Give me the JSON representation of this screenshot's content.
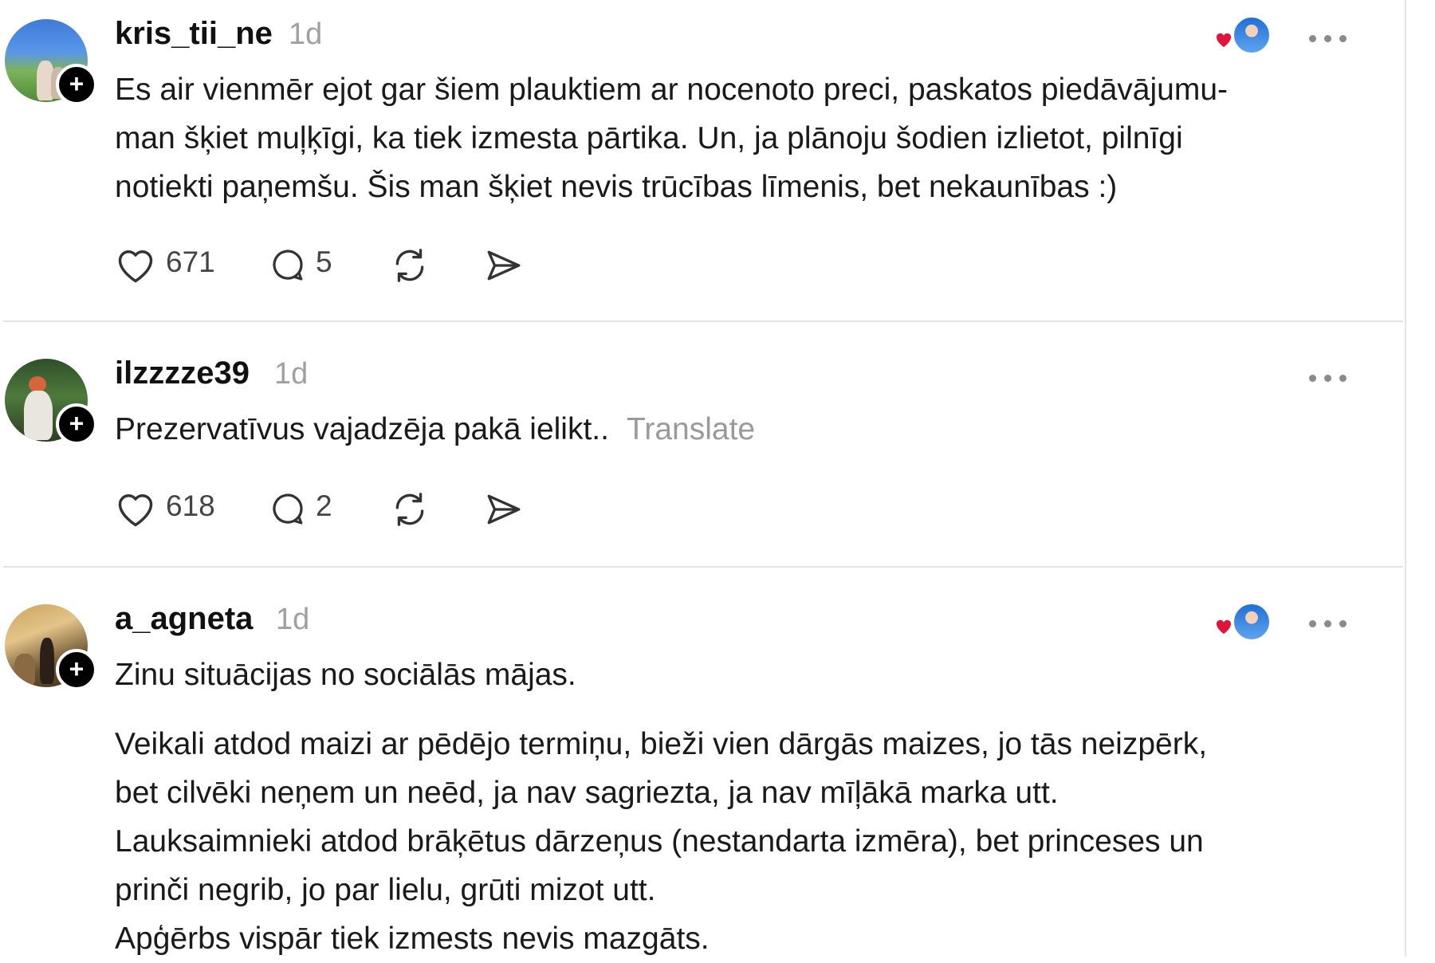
{
  "posts": [
    {
      "username": "kris_tii_ne",
      "time": "1d",
      "text_lines": [
        "Es air vienmēr ejot gar šiem plauktiem ar nocenoto preci, paskatos piedāvājumu-",
        "man šķiet muļķīgi, ka tiek izmesta pārtika. Un, ja plānoju šodien izlietot, pilnīgi",
        "notiekti paņemšu. Šis man šķiet nevis trūcības līmenis, bet nekaunības :)"
      ],
      "likes": "671",
      "replies": "5",
      "liked_by_indicator": true
    },
    {
      "username": "ilzzzze39",
      "time": "1d",
      "text": "Prezervatīvus vajadzēja pakā ielikt..",
      "translate_label": "Translate",
      "likes": "618",
      "replies": "2",
      "liked_by_indicator": false
    },
    {
      "username": "a_agneta",
      "time": "1d",
      "text_first": "Zinu situācijas no sociālās mājas.",
      "text_lines": [
        "Veikali atdod maizi ar pēdējo termiņu, bieži vien dārgās maizes, jo tās neizpērk,",
        "bet cilvēki neņem un neēd, ja nav sagriezta, ja nav mīļākā marka utt.",
        "Lauksaimnieki atdod brāķētus dārzeņus (nestandarta izmēra), bet princeses un",
        "prinči negrib, jo par lielu, grūti mizot utt.",
        "Apģērbs vispār tiek izmests nevis mazgāts."
      ],
      "liked_by_indicator": true
    }
  ],
  "icons": {
    "like": "heart-outline-icon",
    "reply": "speech-bubble-icon",
    "repost": "repost-icon",
    "share": "send-icon",
    "more": "more-horizontal-icon",
    "follow": "plus-icon"
  },
  "colors": {
    "heart_red": "#e3143c",
    "muted_text": "#a0a0a0",
    "divider": "#e4e4e4"
  }
}
